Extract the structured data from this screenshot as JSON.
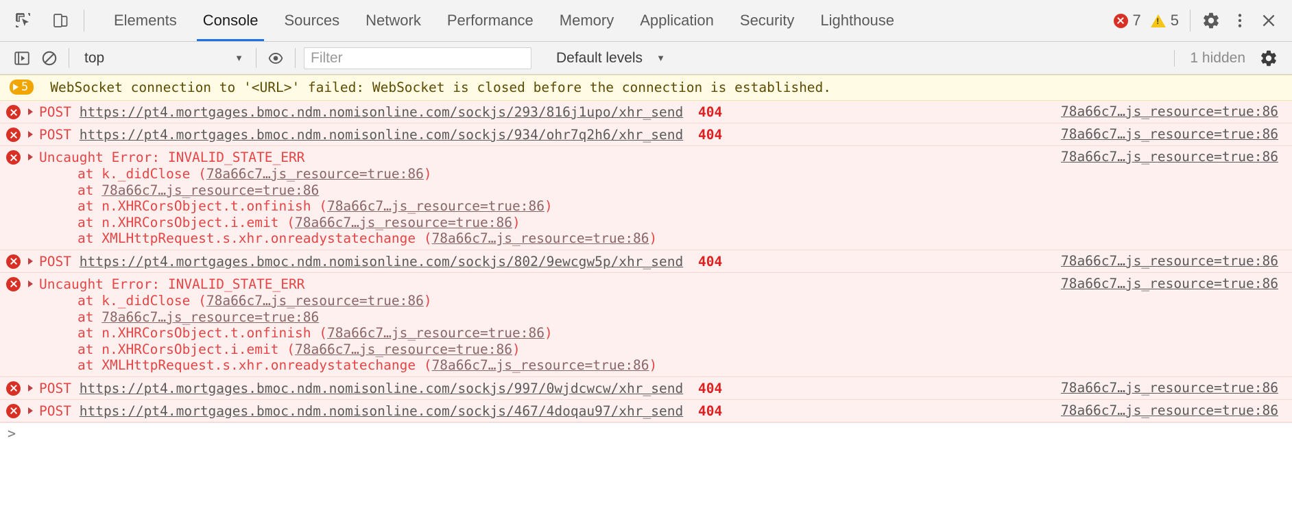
{
  "devtools": {
    "tabs": [
      {
        "id": "elements",
        "label": "Elements",
        "active": false
      },
      {
        "id": "console",
        "label": "Console",
        "active": true
      },
      {
        "id": "sources",
        "label": "Sources",
        "active": false
      },
      {
        "id": "network",
        "label": "Network",
        "active": false
      },
      {
        "id": "performance",
        "label": "Performance",
        "active": false
      },
      {
        "id": "memory",
        "label": "Memory",
        "active": false
      },
      {
        "id": "application",
        "label": "Application",
        "active": false
      },
      {
        "id": "security",
        "label": "Security",
        "active": false
      },
      {
        "id": "lighthouse",
        "label": "Lighthouse",
        "active": false
      }
    ],
    "counts": {
      "errors": "7",
      "warnings": "5"
    },
    "icons": {
      "inspect": "inspect-element-icon",
      "device": "device-toolbar-icon",
      "settings": "gear-icon",
      "more": "kebab-menu-icon",
      "close": "close-icon"
    },
    "accent_color": "#1a73e8",
    "error_color": "#d93025",
    "warning_color": "#f5c518"
  },
  "filterbar": {
    "execute_label": "execute-script-icon",
    "clear_label": "clear-console-icon",
    "context": "top",
    "context_caret": "▼",
    "eye_label": "live-expression-icon",
    "filter_value": "",
    "filter_placeholder": "Filter",
    "levels_label": "Default levels",
    "levels_caret": "▼",
    "hidden_label": "1 hidden",
    "settings_label": "console-settings-icon"
  },
  "console": {
    "warning_banner": {
      "count": "5",
      "text": "WebSocket connection to '<URL>' failed: WebSocket is closed before the connection is established."
    },
    "entries": [
      {
        "type": "network",
        "method": "POST",
        "url": "https://pt4.mortgages.bmoc.ndm.nomisonline.com/sockjs/293/816j1upo/xhr_send",
        "status": "404",
        "source": "78a66c7…js_resource=true:86"
      },
      {
        "type": "network",
        "method": "POST",
        "url": "https://pt4.mortgages.bmoc.ndm.nomisonline.com/sockjs/934/ohr7q2h6/xhr_send",
        "status": "404",
        "source": "78a66c7…js_resource=true:86"
      },
      {
        "type": "exception",
        "title": "Uncaught Error: INVALID_STATE_ERR",
        "source": "78a66c7…js_resource=true:86",
        "stack": [
          {
            "prefix": "at k._didClose (",
            "link": "78a66c7…js_resource=true:86",
            "suffix": ")"
          },
          {
            "prefix": "at ",
            "link": "78a66c7…js_resource=true:86",
            "suffix": ""
          },
          {
            "prefix": "at n.XHRCorsObject.t.onfinish (",
            "link": "78a66c7…js_resource=true:86",
            "suffix": ")"
          },
          {
            "prefix": "at n.XHRCorsObject.i.emit (",
            "link": "78a66c7…js_resource=true:86",
            "suffix": ")"
          },
          {
            "prefix": "at XMLHttpRequest.s.xhr.onreadystatechange (",
            "link": "78a66c7…js_resource=true:86",
            "suffix": ")"
          }
        ]
      },
      {
        "type": "network",
        "method": "POST",
        "url": "https://pt4.mortgages.bmoc.ndm.nomisonline.com/sockjs/802/9ewcgw5p/xhr_send",
        "status": "404",
        "source": "78a66c7…js_resource=true:86"
      },
      {
        "type": "exception",
        "title": "Uncaught Error: INVALID_STATE_ERR",
        "source": "78a66c7…js_resource=true:86",
        "stack": [
          {
            "prefix": "at k._didClose (",
            "link": "78a66c7…js_resource=true:86",
            "suffix": ")"
          },
          {
            "prefix": "at ",
            "link": "78a66c7…js_resource=true:86",
            "suffix": ""
          },
          {
            "prefix": "at n.XHRCorsObject.t.onfinish (",
            "link": "78a66c7…js_resource=true:86",
            "suffix": ")"
          },
          {
            "prefix": "at n.XHRCorsObject.i.emit (",
            "link": "78a66c7…js_resource=true:86",
            "suffix": ")"
          },
          {
            "prefix": "at XMLHttpRequest.s.xhr.onreadystatechange (",
            "link": "78a66c7…js_resource=true:86",
            "suffix": ")"
          }
        ]
      },
      {
        "type": "network",
        "method": "POST",
        "url": "https://pt4.mortgages.bmoc.ndm.nomisonline.com/sockjs/997/0wjdcwcw/xhr_send",
        "status": "404",
        "source": "78a66c7…js_resource=true:86"
      },
      {
        "type": "network",
        "method": "POST",
        "url": "https://pt4.mortgages.bmoc.ndm.nomisonline.com/sockjs/467/4doqau97/xhr_send",
        "status": "404",
        "source": "78a66c7…js_resource=true:86"
      }
    ],
    "prompt": ">"
  }
}
